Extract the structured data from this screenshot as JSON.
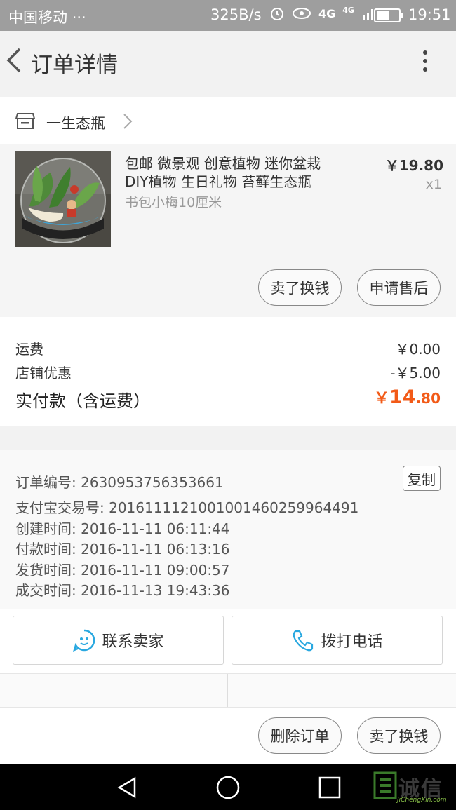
{
  "status_bar": {
    "carrier": "中国移动",
    "dots": "···",
    "speed": "325B/s",
    "network": "4G",
    "network2": "4G",
    "battery_level": 0.55,
    "time": "19:51"
  },
  "header": {
    "title": "订单详情"
  },
  "shop": {
    "name": "一生态瓶"
  },
  "product": {
    "title_line1": "包邮 微景观 创意植物 迷你盆栽",
    "title_line2": "DIY植物 生日礼物 苔藓生态瓶",
    "sku": "书包小梅10厘米",
    "price": "￥19.80",
    "quantity": "x1",
    "sell_label": "卖了换钱",
    "after_sale_label": "申请售后"
  },
  "summary": {
    "shipping_label": "运费",
    "shipping_value": "￥0.00",
    "discount_label": "店铺优惠",
    "discount_value": "-￥5.00",
    "total_label": "实付款（含运费）",
    "total_currency": "￥",
    "total_int": "14",
    "total_dec": ".80"
  },
  "order_info": {
    "order_no": "订单编号: 2630953756353661",
    "copy_label": "复制",
    "alipay_no": "支付宝交易号: 2016111121001001460259964491",
    "created": "创建时间: 2016-11-11 06:11:44",
    "paid": "付款时间: 2016-11-11 06:13:16",
    "shipped": "发货时间: 2016-11-11 09:00:57",
    "completed": "成交时间: 2016-11-13 19:43:36"
  },
  "contact": {
    "seller_label": "联系卖家",
    "call_label": "拨打电话"
  },
  "bottom_bar": {
    "delete_label": "删除订单",
    "sell_label": "卖了换钱"
  },
  "watermark": {
    "text": "诚信",
    "sub": "JiChengXin.com"
  },
  "colors": {
    "accent": "#f25a17",
    "chat_icon": "#29a8e0"
  }
}
